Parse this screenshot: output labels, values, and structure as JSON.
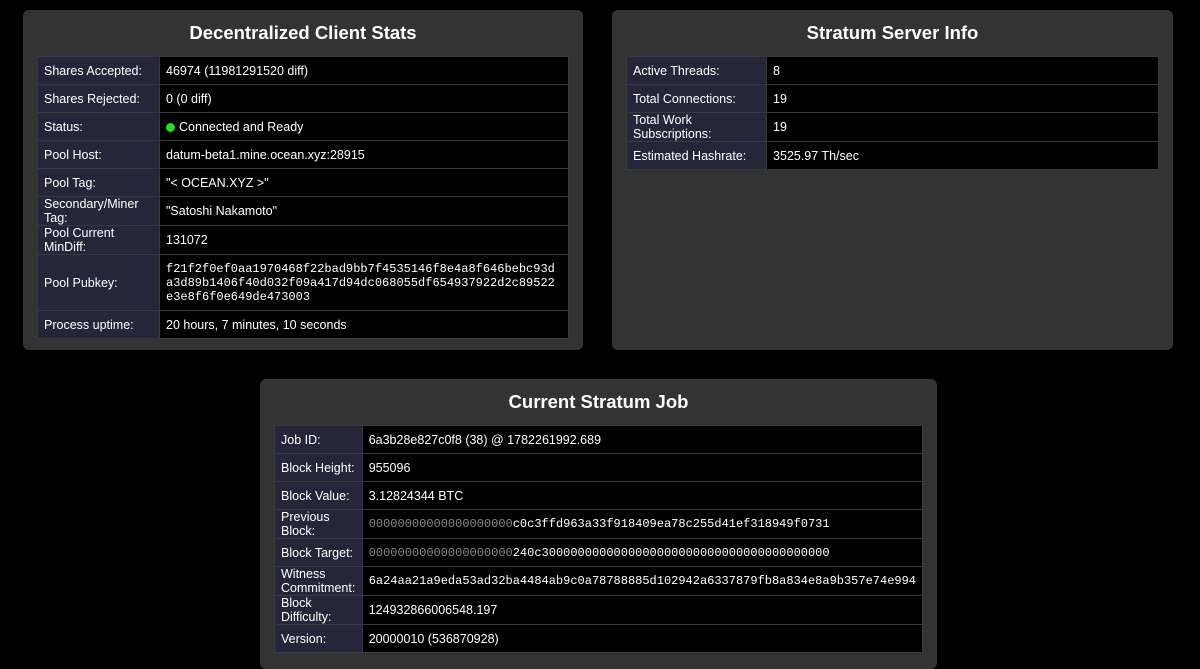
{
  "client": {
    "title": "Decentralized Client Stats",
    "shares_accepted_label": "Shares Accepted:",
    "shares_accepted": "46974 (11981291520 diff)",
    "shares_rejected_label": "Shares Rejected:",
    "shares_rejected": "0 (0 diff)",
    "status_label": "Status:",
    "status": "Connected and Ready",
    "status_color": "#22dd22",
    "pool_host_label": "Pool Host:",
    "pool_host": "datum-beta1.mine.ocean.xyz:28915",
    "pool_tag_label": "Pool Tag:",
    "pool_tag": "\"< OCEAN.XYZ >\"",
    "secondary_tag_label": "Secondary/Miner Tag:",
    "secondary_tag": "\"Satoshi Nakamoto\"",
    "min_diff_label": "Pool Current MinDiff:",
    "min_diff": "131072",
    "pubkey_label": "Pool Pubkey:",
    "pubkey": "f21f2f0ef0aa1970468f22bad9bb7f4535146f8e4a8f646bebc93da3d89b1406f40d032f09a417d94dc068055df654937922d2c89522e3e8f6f0e649de473003",
    "uptime_label": "Process uptime:",
    "uptime": "20 hours, 7 minutes, 10 seconds"
  },
  "server": {
    "title": "Stratum Server Info",
    "threads_label": "Active Threads:",
    "threads": "8",
    "connections_label": "Total Connections:",
    "connections": "19",
    "subscriptions_label": "Total Work Subscriptions:",
    "subscriptions": "19",
    "hashrate_label": "Estimated Hashrate:",
    "hashrate": "3525.97 Th/sec"
  },
  "job": {
    "title": "Current Stratum Job",
    "job_id_label": "Job ID:",
    "job_id": "6a3b28e827c0f8 (38) @ 1782261992.689",
    "height_label": "Block Height:",
    "height": "955096",
    "value_label": "Block Value:",
    "value": "3.12824344 BTC",
    "prev_block_label": "Previous Block:",
    "prev_block_zeros": "00000000000000000000",
    "prev_block_rest": "c0c3ffd963a33f918409ea78c255d41ef318949f0731",
    "target_label": "Block Target:",
    "target_zeros": "00000000000000000000",
    "target_rest": "240c3000000000000000000000000000000000000000",
    "witness_label": "Witness Commitment:",
    "witness": "6a24aa21a9eda53ad32ba4484ab9c0a78788885d102942a6337879fb8a834e8a9b357e74e994",
    "difficulty_label": "Block Difficulty:",
    "difficulty": "124932866006548.197",
    "version_label": "Version:",
    "version": "20000010 (536870928)"
  }
}
